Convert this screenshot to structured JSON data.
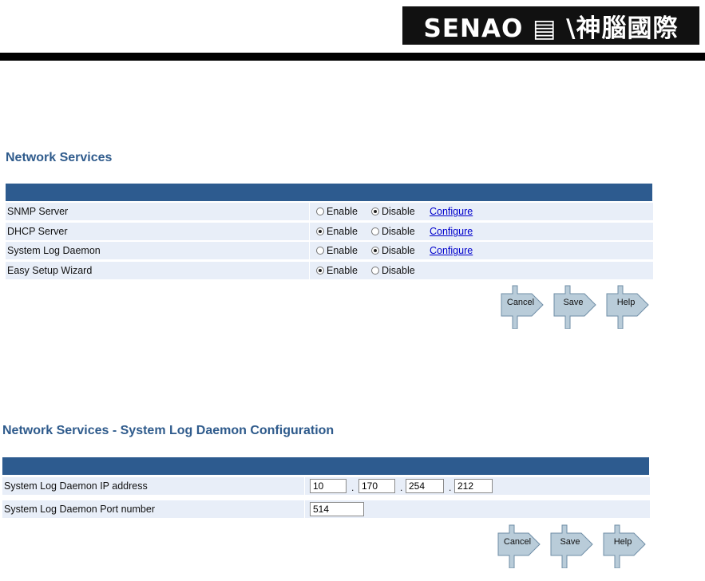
{
  "header": {
    "brand": "SENAO",
    "brand_cn": "神腦國際"
  },
  "network_services": {
    "title": "Network Services",
    "enable_label": "Enable",
    "disable_label": "Disable",
    "configure_label": "Configure",
    "rows": [
      {
        "label": "SNMP Server",
        "selected": "disable",
        "configure": true
      },
      {
        "label": "DHCP Server",
        "selected": "enable",
        "configure": true
      },
      {
        "label": "System Log Daemon",
        "selected": "disable",
        "configure": true
      },
      {
        "label": "Easy Setup Wizard",
        "selected": "enable",
        "configure": false
      }
    ],
    "buttons": {
      "cancel": "Cancel",
      "save": "Save",
      "help": "Help"
    }
  },
  "syslog_config": {
    "title": "Network Services - System Log Daemon Configuration",
    "ip_label": "System Log Daemon IP address",
    "ip": [
      "10",
      "170",
      "254",
      "212"
    ],
    "port_label": "System Log Daemon Port number",
    "port": "514",
    "buttons": {
      "cancel": "Cancel",
      "save": "Save",
      "help": "Help"
    }
  },
  "colors": {
    "header_bar": "#2d5b8f",
    "row_bg": "#e8eef8",
    "title": "#2f5b8c"
  },
  "icons": [
    "arrow-button-icon"
  ]
}
